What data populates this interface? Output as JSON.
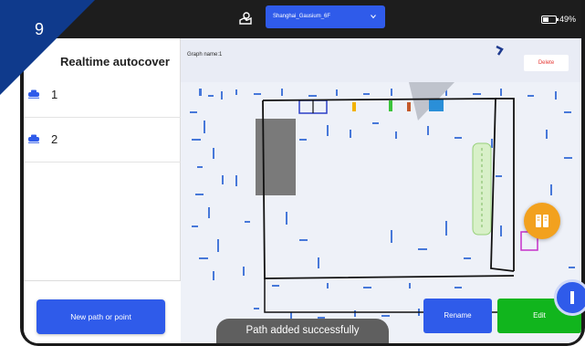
{
  "topbar": {
    "map_name": "Shanghai_Gausium_6F",
    "battery_percent": "49%",
    "battery_level": 0.49,
    "icons": {
      "route": "route-pin-icon",
      "dropdown": "chevron-down-icon",
      "battery": "battery-icon"
    }
  },
  "step_badge": {
    "number": "9",
    "color": "#0f3a8c"
  },
  "left_panel": {
    "title": "Realtime autocover",
    "items": [
      {
        "label": "1",
        "icon": "robot-icon"
      },
      {
        "label": "2",
        "icon": "robot-icon"
      }
    ],
    "new_path_label": "New path or point"
  },
  "map": {
    "graph_name": "Graph name:1",
    "delete_label": "Delete",
    "rename_label": "Rename",
    "edit_label": "Edit"
  },
  "toast": {
    "message": "Path added successfully"
  },
  "colors": {
    "primary_blue": "#2f5bea",
    "edit_green": "#11b51d",
    "delete_red": "#e53935",
    "guide_orange": "#f2a11e",
    "statusbar": "#1d1d1d"
  }
}
